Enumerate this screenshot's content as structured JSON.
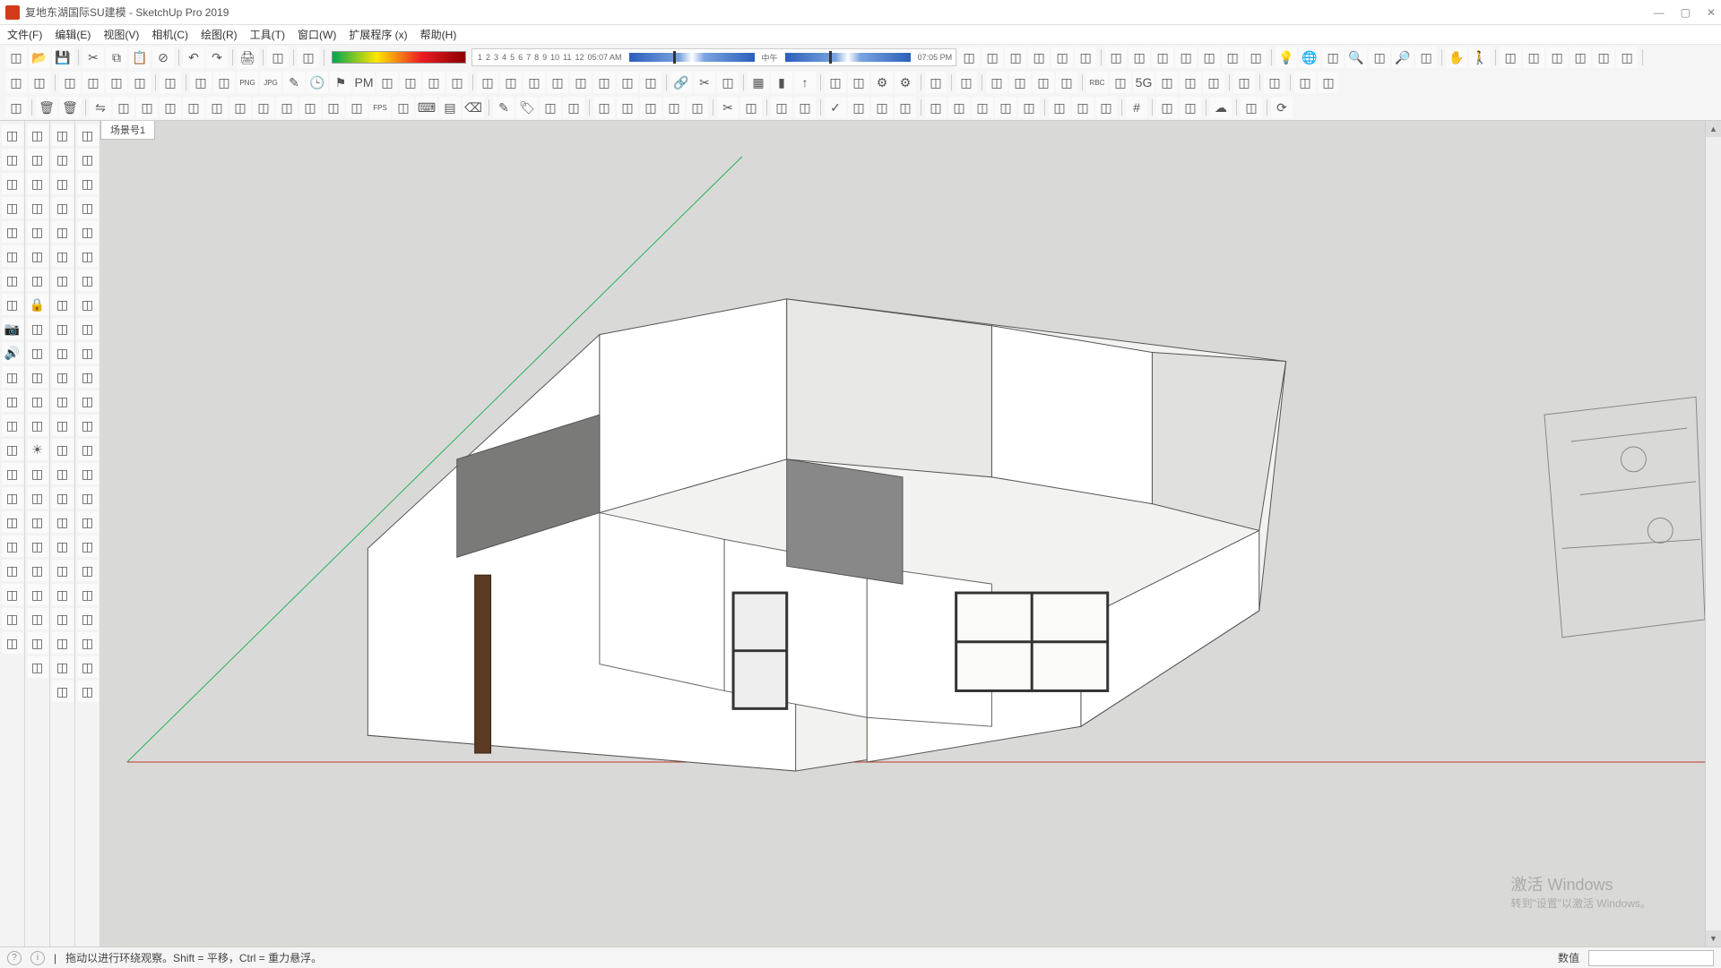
{
  "window": {
    "title": "复地东湖国际SU建模 - SketchUp Pro 2019",
    "min": "—",
    "max": "▢",
    "close": "✕"
  },
  "menu": {
    "file": "文件(F)",
    "edit": "编辑(E)",
    "view": "视图(V)",
    "camera": "相机(C)",
    "draw": "绘图(R)",
    "tools": "工具(T)",
    "window": "窗口(W)",
    "ext": "扩展程序 (x)",
    "help": "帮助(H)"
  },
  "timebar": {
    "numbers": [
      "1",
      "2",
      "3",
      "4",
      "5",
      "6",
      "7",
      "8",
      "9",
      "10",
      "11",
      "12"
    ],
    "start": "05:07 AM",
    "mid": "中午",
    "end": "07:05 PM"
  },
  "scene_tab": "场景号1",
  "status": {
    "msg": "拖动以进行环绕观察。Shift = 平移，Ctrl = 重力悬浮。",
    "value_label": "数值"
  },
  "activate": {
    "title": "激活 Windows",
    "sub": "转到\"设置\"以激活 Windows。"
  },
  "tool_rows": {
    "row1": [
      "docs-icon",
      "open-icon",
      "save-icon",
      "sep",
      "cut-icon",
      "copy-icon",
      "paste-icon",
      "delete-icon",
      "sep",
      "undo-icon",
      "redo-icon",
      "sep",
      "print-icon",
      "sep",
      "model-icon",
      "sep",
      "cube-icon",
      "sep"
    ],
    "row1b": [
      "house1-icon",
      "house2-icon",
      "house3-icon",
      "roof1-icon",
      "roof2-icon",
      "roof3-icon",
      "sep",
      "box1-icon",
      "box2-icon",
      "box3-icon",
      "box4-icon",
      "box5-icon",
      "box6-icon",
      "box7-icon",
      "sep",
      "bulb-icon",
      "globe-icon",
      "flash-icon",
      "search-icon",
      "sel-icon",
      "zoom-icon",
      "extent-icon",
      "sep",
      "hand-icon",
      "walk-icon",
      "sep",
      "red1-icon",
      "red2-icon",
      "red3-icon",
      "red4-icon",
      "red5-icon",
      "red6-icon",
      "sep"
    ],
    "row2": [
      "sel2-icon",
      "rect-icon",
      "sep",
      "grp1-icon",
      "grp2-icon",
      "grp3-icon",
      "grp4-icon",
      "sep",
      "move-icon",
      "sep",
      "fold1-icon",
      "fold2-icon",
      "png-icon",
      "jpg-icon",
      "pen-icon",
      "clock-icon",
      "flag-icon",
      "pm-icon",
      "doc1-icon",
      "doc2-icon",
      "exp1-icon",
      "exp2-icon",
      "sep",
      "db1-icon",
      "db2-icon",
      "db3-icon",
      "db4-icon",
      "db5-icon",
      "db6-icon",
      "db7-icon",
      "db8-icon",
      "sep",
      "link-icon",
      "scis-icon",
      "arc-icon",
      "sep",
      "grid-icon",
      "pal-icon",
      "up-icon",
      "sep",
      "dn1-icon",
      "dn2-icon",
      "gear1-icon",
      "gear2-icon",
      "sep",
      "shld-icon",
      "sep",
      "gem-icon",
      "sep",
      "c1-icon",
      "c2-icon",
      "c3-icon",
      "c4-icon",
      "sep",
      "rbc-icon",
      "sh2-icon",
      "5g-icon",
      "l1-icon",
      "l2-icon",
      "l3-icon",
      "sep",
      "db9-icon",
      "sep",
      "sq1-icon",
      "sep",
      "line1-icon",
      "line2-icon"
    ],
    "row3": [
      "col1-icon",
      "sep",
      "trash-icon",
      "trash2-icon",
      "sep",
      "flip-icon",
      "bird-icon",
      "fish-icon",
      "pkg-icon",
      "box-icon",
      "pyr-icon",
      "cub1-icon",
      "cub2-icon",
      "cub3-icon",
      "brick-icon",
      "bot-icon",
      "arc2-icon",
      "fps-icon",
      "fs-icon",
      "key-icon",
      "rainbow-icon",
      "eraser-icon",
      "sep",
      "edit-icon",
      "tag-icon",
      "sel3-icon",
      "move2-icon",
      "sep",
      "er2-icon",
      "cube2-icon",
      "wall-icon",
      "pl1-icon",
      "pl2-icon",
      "sep",
      "sc2-icon",
      "scl-icon",
      "sep",
      "sq2-icon",
      "sq3-icon",
      "sep",
      "chk-icon",
      "mt1-icon",
      "mt2-icon",
      "mt3-icon",
      "sep",
      "grf-icon",
      "ln1-icon",
      "ln2-icon",
      "ln3-icon",
      "ln4-icon",
      "sep",
      "sp1-icon",
      "sp2-icon",
      "sp3-icon",
      "sep",
      "num-icon",
      "sep",
      "drag-icon",
      "sel4-icon",
      "sep",
      "sky-icon",
      "sep",
      "circ-icon",
      "sep",
      "rot-icon"
    ]
  },
  "side_cols": [
    [
      "cube-s1",
      "circ-s1",
      "3d-s1",
      "cld-s1",
      "s1a",
      "s1b",
      "s1c",
      "s1d",
      "cam-s1",
      "snd-s1",
      "s1e",
      "s1f",
      "s1g",
      "s1h",
      "s1i",
      "s1j",
      "s1k",
      "s1l",
      "s1m",
      "s1n",
      "s1o",
      "s1p"
    ],
    [
      "cir2",
      "hand2",
      "cld2",
      "s2a",
      "s2b",
      "s2c",
      "s2d",
      "lock2",
      "s2e",
      "s2f",
      "s2g",
      "s2h",
      "s2i",
      "sun2",
      "s2j",
      "s2k",
      "s2l",
      "s2m",
      "s2n",
      "s2o",
      "s2p",
      "s2q",
      "s2r"
    ],
    [
      "l3a",
      "l3b",
      "l3c",
      "l3d",
      "l3e",
      "l3f",
      "l3g",
      "l3h",
      "l3i",
      "l3j",
      "l3k",
      "l3l",
      "l3m",
      "l3n",
      "l3o",
      "l3p",
      "l3q",
      "l3r",
      "l3s",
      "l3t",
      "l3u",
      "l3v",
      "l3w",
      "l3x"
    ],
    [
      "b4a",
      "b4b",
      "b4c",
      "b4d",
      "b4e",
      "b4f",
      "b4g",
      "b4h",
      "b4i",
      "b4j",
      "b4k",
      "b4l",
      "b4m",
      "b4n",
      "b4o",
      "b4p",
      "b4q",
      "b4r",
      "b4s",
      "b4t",
      "b4u",
      "b4v",
      "b4w",
      "b4x"
    ]
  ]
}
